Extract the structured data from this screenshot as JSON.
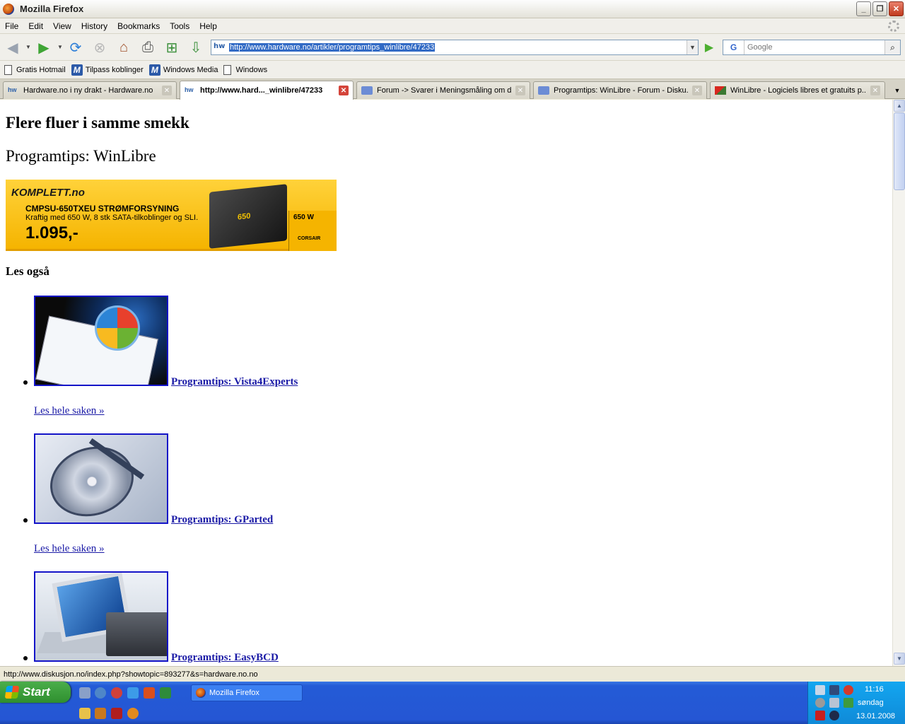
{
  "window": {
    "title": "Mozilla Firefox"
  },
  "menu": [
    "File",
    "Edit",
    "View",
    "History",
    "Bookmarks",
    "Tools",
    "Help"
  ],
  "nav": {
    "url": "http://www.hardware.no/artikler/programtips_winlibre/47233",
    "search_placeholder": "Google",
    "site_icon_label": "hw",
    "search_engine_label": "G"
  },
  "bookmarks": [
    {
      "label": "Gratis Hotmail",
      "icon": "page-icon"
    },
    {
      "label": "Tilpass koblinger",
      "icon": "msn-icon"
    },
    {
      "label": "Windows Media",
      "icon": "msn-icon"
    },
    {
      "label": "Windows",
      "icon": "page-icon"
    }
  ],
  "tabs": [
    {
      "label": "Hardware.no i ny drakt - Hardware.no",
      "active": false
    },
    {
      "label": "http://www.hard..._winlibre/47233",
      "active": true
    },
    {
      "label": "Forum -> Svarer i Meningsmåling om d...",
      "active": false
    },
    {
      "label": "Programtips: WinLibre - Forum - Disku...",
      "active": false
    },
    {
      "label": "WinLibre - Logiciels libres et gratuits p...",
      "active": false
    }
  ],
  "page": {
    "heading1": "Flere fluer i samme smekk",
    "heading2": "Programtips: WinLibre",
    "banner": {
      "brand": "KOMPLETT.no",
      "product": "CMPSU-650TXEU STRØMFORSYNING",
      "description": "Kraftig med 650 W, 8 stk SATA-tilkoblinger og SLI.",
      "price": "1.095,-",
      "watt": "650 W",
      "psu_label": "650",
      "maker": "CORSAIR"
    },
    "section_title": "Les også",
    "articles": [
      {
        "title": "Programtips: Vista4Experts",
        "read_more": "Les hele saken »"
      },
      {
        "title": "Programtips: GParted",
        "read_more": "Les hele saken »"
      },
      {
        "title": "Programtips: EasyBCD"
      }
    ]
  },
  "status": "http://www.diskusjon.no/index.php?showtopic=893277&s=hardware.no.no",
  "taskbar": {
    "start": "Start",
    "task": "Mozilla Firefox",
    "time": "11:16",
    "day": "søndag",
    "date": "13.01.2008"
  }
}
